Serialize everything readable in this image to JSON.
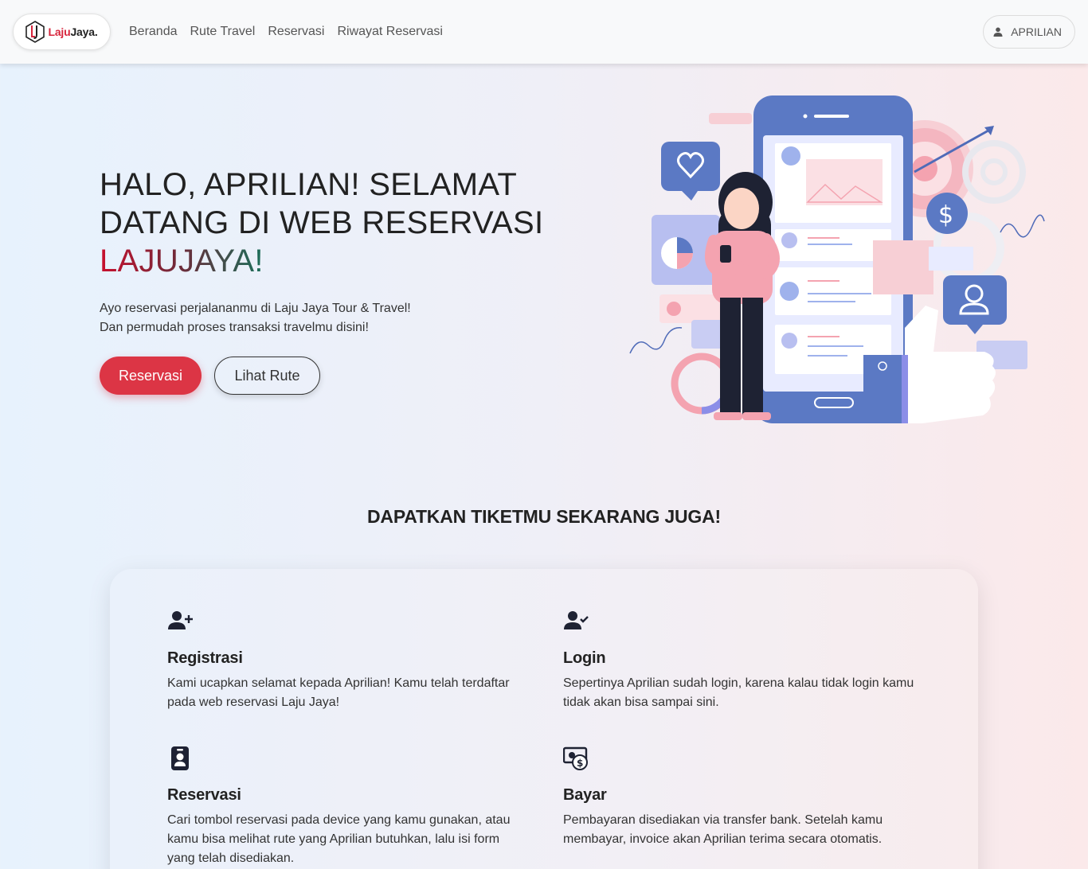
{
  "navbar": {
    "brand": {
      "part1": "Laju",
      "part2": "Jaya."
    },
    "links": [
      "Beranda",
      "Rute Travel",
      "Reservasi",
      "Riwayat Reservasi"
    ],
    "user": "APRILIAN"
  },
  "hero": {
    "title_line1": "HALO, APRILIAN! SELAMAT",
    "title_line2": "DATANG DI WEB RESERVASI",
    "title_brand": "LAJUJAYA!",
    "sub_line1": "Ayo reservasi perjalananmu di Laju Jaya Tour & Travel!",
    "sub_line2": "Dan permudah proses transaksi travelmu disini!",
    "btn_primary": "Reservasi",
    "btn_secondary": "Lihat Rute"
  },
  "section": {
    "title": "DAPATKAN TIKETMU SEKARANG JUGA!",
    "features": [
      {
        "icon": "user-plus-icon",
        "title": "Registrasi",
        "text": "Kami ucapkan selamat kepada Aprilian! Kamu telah terdaftar pada web reservasi Laju Jaya!"
      },
      {
        "icon": "user-check-icon",
        "title": "Login",
        "text": "Sepertinya Aprilian sudah login, karena kalau tidak login kamu tidak akan bisa sampai sini."
      },
      {
        "icon": "badge-icon",
        "title": "Reservasi",
        "text": "Cari tombol reservasi pada device yang kamu gunakan, atau kamu bisa melihat rute yang Aprilian butuhkan, lalu isi form yang telah disediakan."
      },
      {
        "icon": "cash-icon",
        "title": "Bayar",
        "text": "Pembayaran disediakan via transfer bank. Setelah kamu membayar, invoice akan Aprilian terima secara otomatis."
      }
    ]
  },
  "colors": {
    "primary": "#dc3545",
    "navbar": "#f8f9fa",
    "text": "#222222"
  }
}
